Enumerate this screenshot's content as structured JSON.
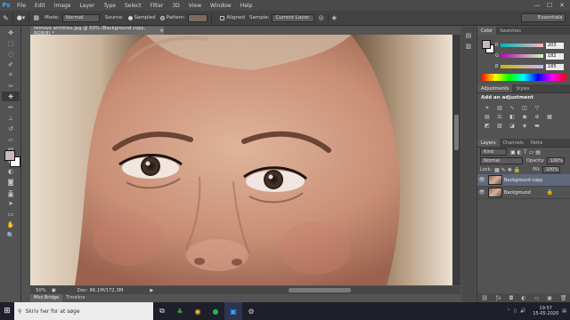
{
  "app": {
    "logo": "Ps"
  },
  "menu": [
    "File",
    "Edit",
    "Image",
    "Layer",
    "Type",
    "Select",
    "Filter",
    "3D",
    "View",
    "Window",
    "Help"
  ],
  "options": {
    "mode_label": "Mode:",
    "mode_value": "Normal",
    "source_label": "Source:",
    "source_sampled": "Sampled",
    "source_pattern": "Pattern:",
    "aligned": "Aligned",
    "sample_label": "Sample:",
    "sample_value": "Current Layer",
    "workspace": "Essentials"
  },
  "document": {
    "tab_title": "remove wrinkles.jpg @ 50% (Background copy, RGB/8) *",
    "zoom": "50%",
    "doc_info": "Doc: 86,1M/172,3M"
  },
  "bottom_tabs": [
    "Mini Bridge",
    "Timeline"
  ],
  "color_panel": {
    "tabs": [
      "Color",
      "Swatches"
    ],
    "r": "203",
    "g": "182",
    "b": "185",
    "fg_color": "#cbb8b9",
    "bg_color": "#ffffff"
  },
  "adjustments": {
    "tabs": [
      "Adjustments",
      "Styles"
    ],
    "title": "Add an adjustment"
  },
  "layers": {
    "tabs": [
      "Layers",
      "Channels",
      "Paths"
    ],
    "kind": "Kind",
    "blend": "Normal",
    "opacity_label": "Opacity:",
    "opacity": "100%",
    "lock_label": "Lock:",
    "fill_label": "Fill:",
    "fill": "100%",
    "items": [
      {
        "name": "Background copy",
        "selected": true
      },
      {
        "name": "Background",
        "selected": false
      }
    ]
  },
  "taskbar": {
    "search_placeholder": "Skriv her for at søge",
    "time": "19:57",
    "date": "15-05-2020"
  }
}
